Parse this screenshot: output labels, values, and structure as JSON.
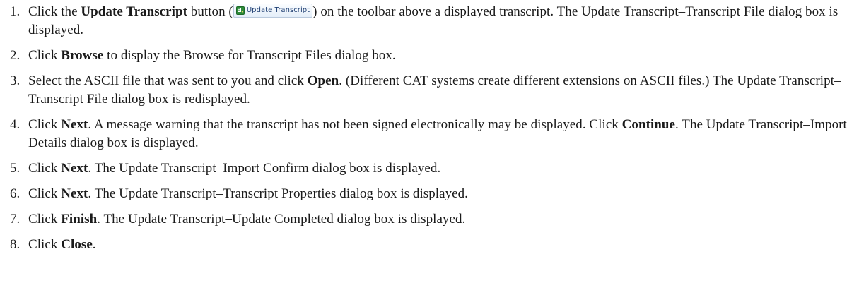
{
  "steps": [
    {
      "num": "1.",
      "t1": "Click the ",
      "b1": "Update Transcript",
      "t2": " button (",
      "button_label": "Update Transcript",
      "t3": ") on the toolbar above a displayed transcript. The Update Transcript–Transcript File dialog box is displayed."
    },
    {
      "num": "2.",
      "t1": "Click ",
      "b1": "Browse",
      "t2": " to display the Browse for Transcript Files dialog box."
    },
    {
      "num": "3.",
      "t1": "Select the ASCII file that was sent to you and click ",
      "b1": "Open",
      "t2": ". (Different CAT systems create different extensions on ASCII files.) The Update Transcript–Transcript File dialog box is redisplayed."
    },
    {
      "num": "4.",
      "t1": "Click ",
      "b1": "Next",
      "t2": ". A message warning that the transcript has not been signed electronically may be displayed. Click ",
      "b2": "Continue",
      "t3": ". The Update Transcript–Import Details dialog box is displayed."
    },
    {
      "num": "5.",
      "t1": "Click ",
      "b1": "Next",
      "t2": ". The Update Transcript–Import Confirm dialog box is displayed."
    },
    {
      "num": "6.",
      "t1": "Click ",
      "b1": "Next",
      "t2": ". The Update Transcript–Transcript Properties dialog box is displayed."
    },
    {
      "num": "7.",
      "t1": "Click ",
      "b1": "Finish",
      "t2": ". The Update Transcript–Update Completed dialog box is displayed."
    },
    {
      "num": "8.",
      "t1": "Click ",
      "b1": "Close",
      "t2": "."
    }
  ],
  "icons": {
    "update_transcript": "update-transcript-icon"
  },
  "colors": {
    "text": "#1a1a1a",
    "button_text": "#1f3f73",
    "icon_green": "#2e8b3a"
  }
}
